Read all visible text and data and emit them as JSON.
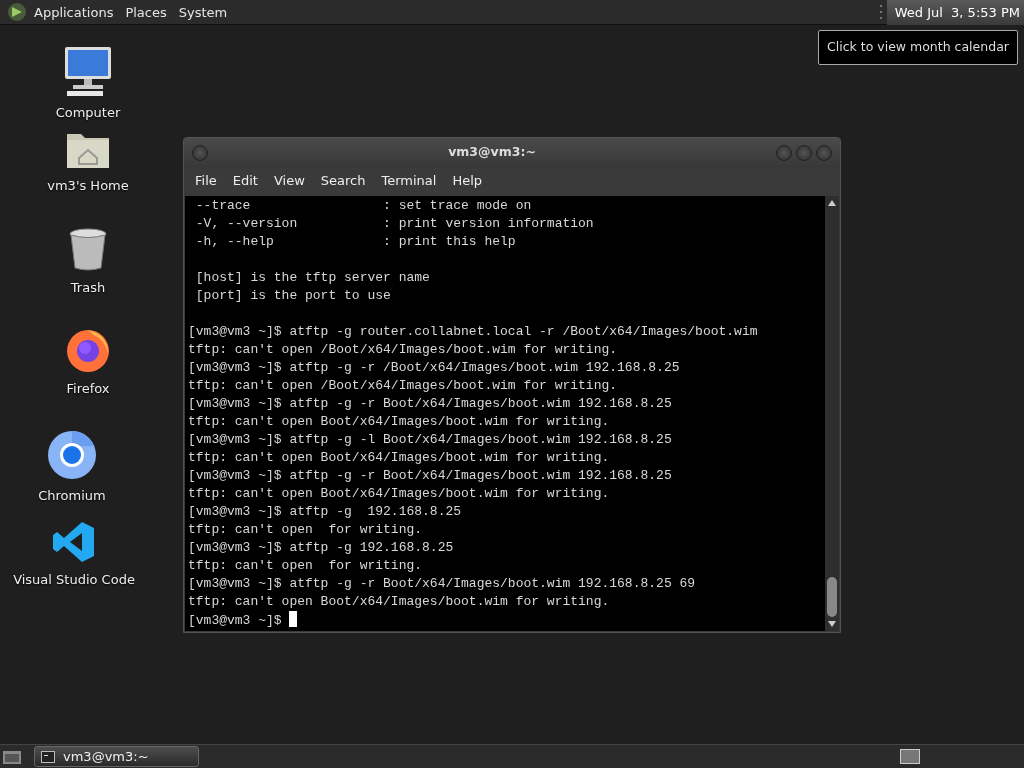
{
  "top_panel": {
    "menus": [
      "Applications",
      "Places",
      "System"
    ],
    "clock": "Wed Jul  3, 5:53 PM",
    "clock_highlighted": true
  },
  "tooltip": "Click to view month calendar",
  "desktop_icons": [
    {
      "kind": "computer",
      "label": "Computer"
    },
    {
      "kind": "home",
      "label": "vm3's Home"
    },
    {
      "kind": "trash",
      "label": "Trash"
    },
    {
      "kind": "firefox",
      "label": "Firefox"
    },
    {
      "kind": "chromium",
      "label": "Chromium"
    },
    {
      "kind": "vscode",
      "label": "Visual Studio Code"
    }
  ],
  "terminal": {
    "title": "vm3@vm3:~",
    "menu": [
      "File",
      "Edit",
      "View",
      "Search",
      "Terminal",
      "Help"
    ],
    "lines": [
      {
        "text": " --trace                 : set trace mode on"
      },
      {
        "text": " -V, --version           : print version information"
      },
      {
        "text": " -h, --help              : print this help"
      },
      {
        "text": " [host] is the tftp server name",
        "gap_before": true
      },
      {
        "text": " [port] is the port to use"
      },
      {
        "text": "[vm3@vm3 ~]$ atftp -g router.collabnet.local -r /Boot/x64/Images/boot.wim",
        "gap_before": true
      },
      {
        "text": "tftp: can't open /Boot/x64/Images/boot.wim for writing."
      },
      {
        "text": "[vm3@vm3 ~]$ atftp -g -r /Boot/x64/Images/boot.wim 192.168.8.25"
      },
      {
        "text": "tftp: can't open /Boot/x64/Images/boot.wim for writing."
      },
      {
        "text": "[vm3@vm3 ~]$ atftp -g -r Boot/x64/Images/boot.wim 192.168.8.25"
      },
      {
        "text": "tftp: can't open Boot/x64/Images/boot.wim for writing."
      },
      {
        "text": "[vm3@vm3 ~]$ atftp -g -l Boot/x64/Images/boot.wim 192.168.8.25"
      },
      {
        "text": "tftp: can't open Boot/x64/Images/boot.wim for writing."
      },
      {
        "text": "[vm3@vm3 ~]$ atftp -g -r Boot/x64/Images/boot.wim 192.168.8.25"
      },
      {
        "text": "tftp: can't open Boot/x64/Images/boot.wim for writing."
      },
      {
        "text": "[vm3@vm3 ~]$ atftp -g  192.168.8.25"
      },
      {
        "text": "tftp: can't open  for writing."
      },
      {
        "text": "[vm3@vm3 ~]$ atftp -g 192.168.8.25"
      },
      {
        "text": "tftp: can't open  for writing."
      },
      {
        "text": "[vm3@vm3 ~]$ atftp -g -r Boot/x64/Images/boot.wim 192.168.8.25 69"
      },
      {
        "text": "tftp: can't open Boot/x64/Images/boot.wim for writing."
      },
      {
        "text": "[vm3@vm3 ~]$ ",
        "cursor": true
      }
    ]
  },
  "taskbar": {
    "tasks": [
      {
        "label": "vm3@vm3:~",
        "selected": true
      }
    ]
  }
}
